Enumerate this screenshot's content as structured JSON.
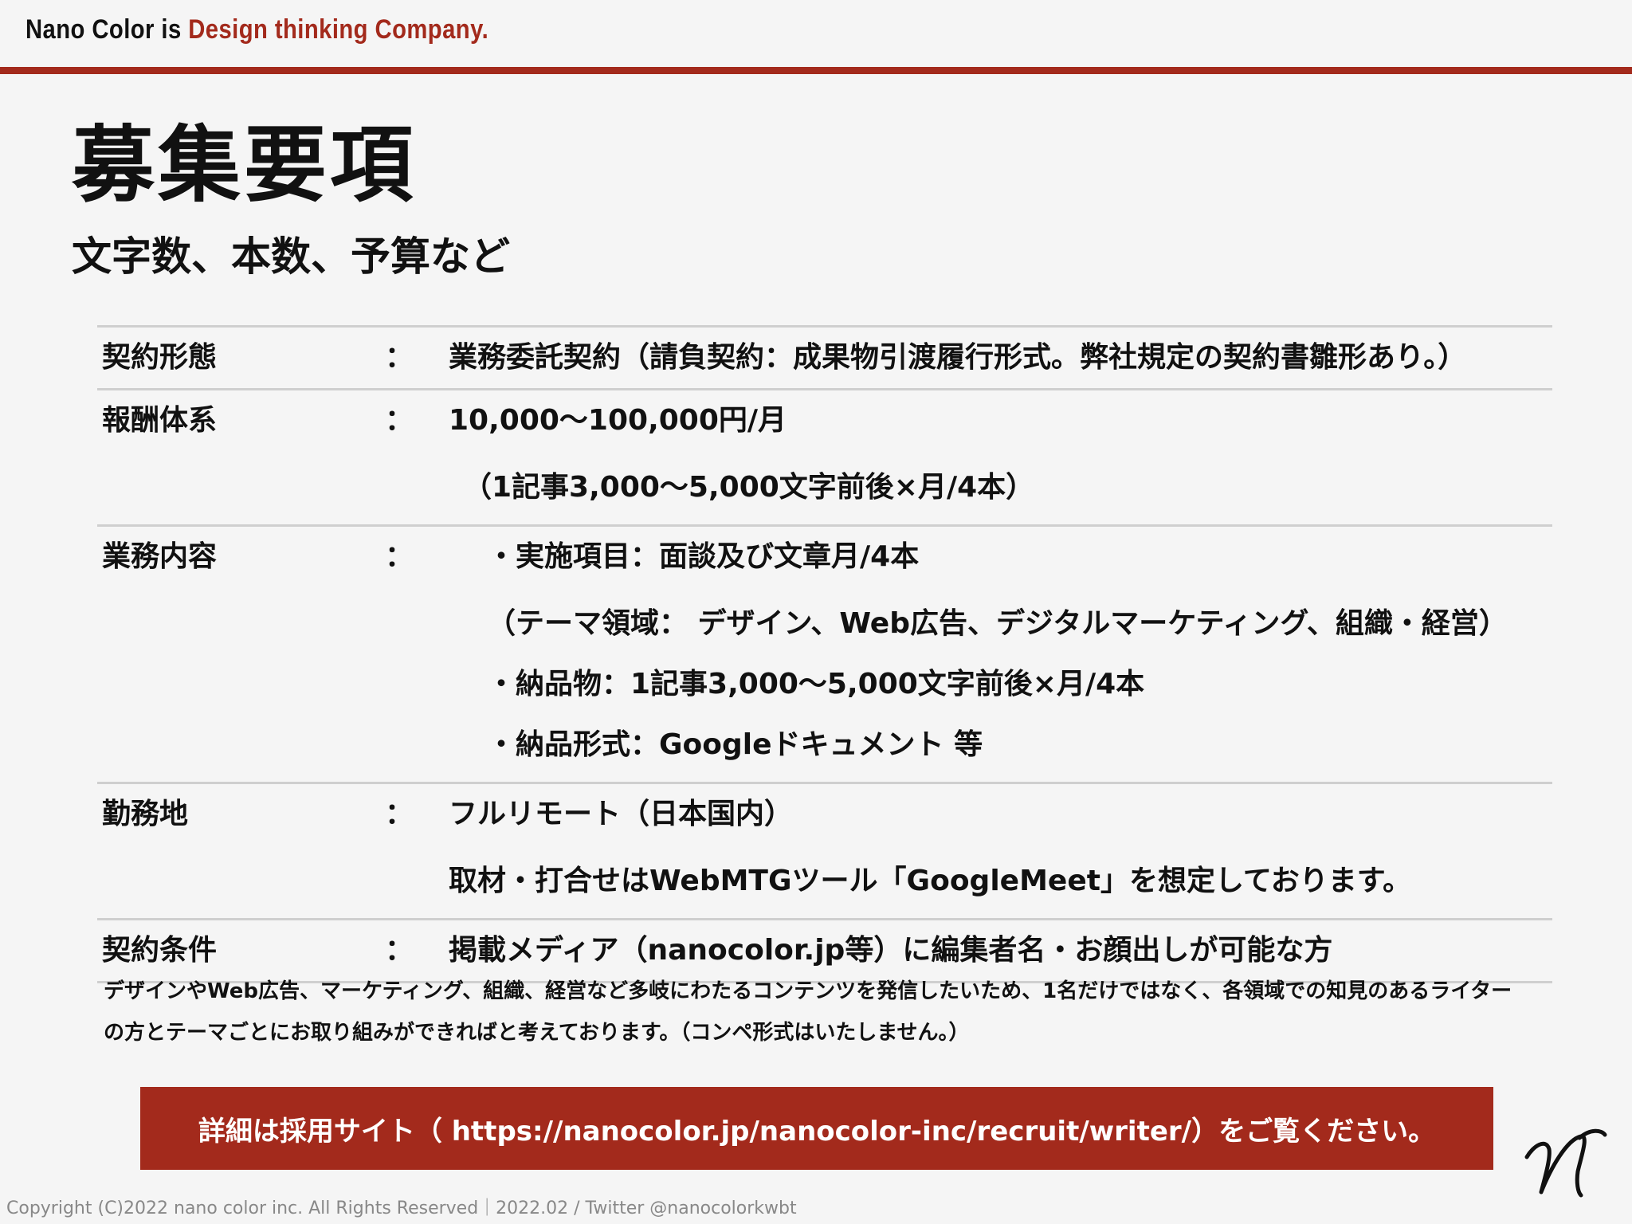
{
  "header": {
    "tagline_prefix": "Nano Color is ",
    "tagline_accent": "Design thinking Company."
  },
  "page": {
    "title": "募集要項",
    "subtitle": "文字数、本数、予算など"
  },
  "terms": [
    {
      "label": "契約形態",
      "colon": "：",
      "lines": [
        "業務委託契約（請負契約：成果物引渡履行形式。弊社規定の契約書雛形あり。）"
      ]
    },
    {
      "label": "報酬体系",
      "colon": "：",
      "lines": [
        "10,000～100,000円/月",
        "（1記事3,000～5,000文字前後×月/4本）"
      ]
    },
    {
      "label": "業務内容",
      "colon": "：",
      "lines": [
        "・実施項目：面談及び文章月/4本",
        "（テーマ領域： デザイン、Web広告、デジタルマーケティング、組織・経営）",
        "・納品物：1記事3,000～5,000文字前後×月/4本",
        "・納品形式：Googleドキュメント 等"
      ]
    },
    {
      "label": "勤務地",
      "colon": "：",
      "lines": [
        "フルリモート（日本国内）",
        "取材・打合せはWebMTGツール「GoogleMeet」を想定しております。"
      ]
    },
    {
      "label": "契約条件",
      "colon": "：",
      "lines": [
        "掲載メディア（nanocolor.jp等）に編集者名・お顔出しが可能な方"
      ]
    }
  ],
  "note": {
    "line1": "デザインやWeb広告、マーケティング、組織、経営など多岐にわたるコンテンツを発信したいため、1名だけではなく、各領域での知見のあるライター",
    "line2": "の方とテーマごとにお取り組みができればと考えております。（コンペ形式はいたしません。）"
  },
  "cta": {
    "label": "詳細は採用サイト（ https://nanocolor.jp/nanocolor-inc/recruit/writer/）をご覧ください。"
  },
  "footer": {
    "text": "Copyright (C)2022 nano color inc. All Rights Reserved｜2022.02 / Twitter @nanocolorkwbt"
  },
  "colors": {
    "accent": "#a32a1c",
    "background": "#f5f5f5",
    "rule": "#cfcfcf"
  },
  "icons": {
    "logo": "nano-color-signature-logo"
  }
}
